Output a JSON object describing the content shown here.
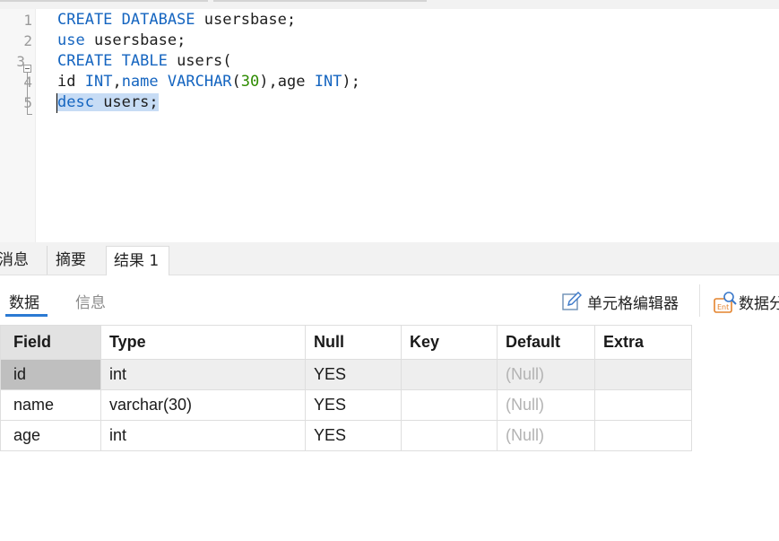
{
  "editor": {
    "line_numbers": [
      "1",
      "2",
      "3",
      "4",
      "5"
    ],
    "lines": [
      [
        {
          "t": "CREATE DATABASE",
          "c": "kw"
        },
        {
          "t": " usersbase;",
          "c": ""
        }
      ],
      [
        {
          "t": "use",
          "c": "kw"
        },
        {
          "t": " usersbase;",
          "c": ""
        }
      ],
      [
        {
          "t": "CREATE TABLE",
          "c": "kw"
        },
        {
          "t": " users(",
          "c": ""
        }
      ],
      [
        {
          "t": "id ",
          "c": ""
        },
        {
          "t": "INT",
          "c": "kw"
        },
        {
          "t": ",",
          "c": ""
        },
        {
          "t": "name",
          "c": "kw"
        },
        {
          "t": " ",
          "c": ""
        },
        {
          "t": "VARCHAR",
          "c": "kw"
        },
        {
          "t": "(",
          "c": ""
        },
        {
          "t": "30",
          "c": "num"
        },
        {
          "t": "),age ",
          "c": ""
        },
        {
          "t": "INT",
          "c": "kw"
        },
        {
          "t": ");",
          "c": ""
        }
      ],
      [
        {
          "t": "desc",
          "c": "kw"
        },
        {
          "t": " users;",
          "c": ""
        }
      ]
    ],
    "selected_line": 5
  },
  "result_tabs": {
    "messages": "消息",
    "summary": "摘要",
    "result1": "结果 1",
    "active": "结果 1"
  },
  "toolbar": {
    "data_tab": "数据",
    "info_tab": "信息",
    "cell_editor": "单元格编辑器",
    "data_gen": "数据分"
  },
  "grid": {
    "columns": [
      "Field",
      "Type",
      "Null",
      "Key",
      "Default",
      "Extra"
    ],
    "rows": [
      [
        "id",
        "int",
        "YES",
        "",
        "(Null)",
        ""
      ],
      [
        "name",
        "varchar(30)",
        "YES",
        "",
        "(Null)",
        ""
      ],
      [
        "age",
        "int",
        "YES",
        "",
        "(Null)",
        ""
      ]
    ]
  },
  "colors": {
    "keyword": "#1565c0",
    "number": "#2e8b00",
    "selection": "#c7dcf5",
    "accent": "#2b7ad3",
    "null_text": "#b3b3b3"
  }
}
